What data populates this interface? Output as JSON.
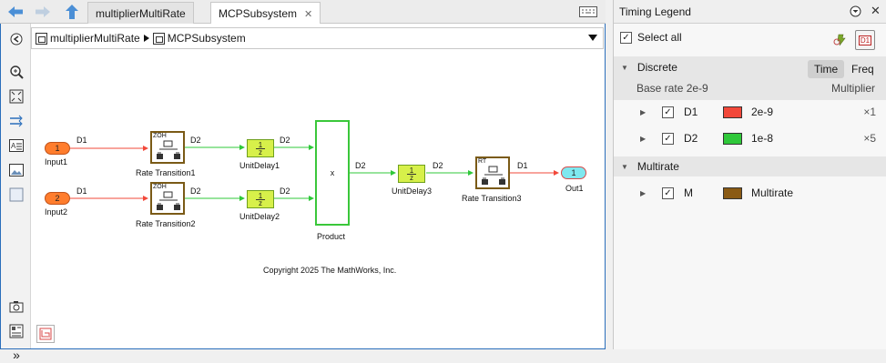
{
  "tabs": [
    {
      "label": "multiplierMultiRate"
    },
    {
      "label": "MCPSubsystem",
      "close": "✕"
    }
  ],
  "breadcrumb": {
    "items": [
      "multiplierMultiRate",
      "MCPSubsystem"
    ]
  },
  "diagram": {
    "inputs": [
      {
        "num": "1",
        "name": "Input1"
      },
      {
        "num": "2",
        "name": "Input2"
      }
    ],
    "output": {
      "num": "1",
      "name": "Out1"
    },
    "rate_transitions": [
      {
        "name": "Rate Transition1",
        "tag": "ZOH"
      },
      {
        "name": "Rate Transition2",
        "tag": "ZOH"
      },
      {
        "name": "Rate Transition3",
        "tag": "RT"
      }
    ],
    "unit_delays": [
      {
        "name": "UnitDelay1",
        "num": "1",
        "den": "z"
      },
      {
        "name": "UnitDelay2",
        "num": "1",
        "den": "z"
      },
      {
        "name": "UnitDelay3",
        "num": "1",
        "den": "z"
      }
    ],
    "product": {
      "name": "Product",
      "symbol": "x"
    },
    "signal_labels": {
      "d1": "D1",
      "d2": "D2"
    },
    "copyright": "Copyright 2025 The MathWorks, Inc."
  },
  "legend": {
    "title": "Timing Legend",
    "select_all": "Select all",
    "badge": "D1",
    "discrete": {
      "label": "Discrete",
      "toggle_time": "Time",
      "toggle_freq": "Freq",
      "base_rate": "Base rate 2e-9",
      "multiplier_header": "Multiplier",
      "rows": [
        {
          "id": "D1",
          "value": "2e-9",
          "mult": "×1",
          "color": "#f2483a"
        },
        {
          "id": "D2",
          "value": "1e-8",
          "mult": "×5",
          "color": "#2fc83a"
        }
      ]
    },
    "multirate": {
      "label": "Multirate",
      "rows": [
        {
          "id": "M",
          "value": "Multirate",
          "color": "#8a5a14"
        }
      ]
    }
  },
  "colors": {
    "accent": "#2a6ebb",
    "rate_d1": "#f2483a",
    "rate_d2": "#2fc83a",
    "rate_multi": "#8a5a14"
  },
  "icons": [
    "back-arrow-icon",
    "forward-arrow-icon",
    "up-arrow-icon",
    "keyboard-icon",
    "hide-browser-icon",
    "zoom-icon",
    "fit-view-icon",
    "signal-lines-icon",
    "annotation-icon",
    "image-icon",
    "area-icon",
    "camera-icon",
    "property-inspector-icon",
    "expand-icon",
    "settings-icon",
    "highlight-icon",
    "dropdown-icon",
    "legend-menu-icon",
    "close-icon",
    "model-corner-icon"
  ]
}
